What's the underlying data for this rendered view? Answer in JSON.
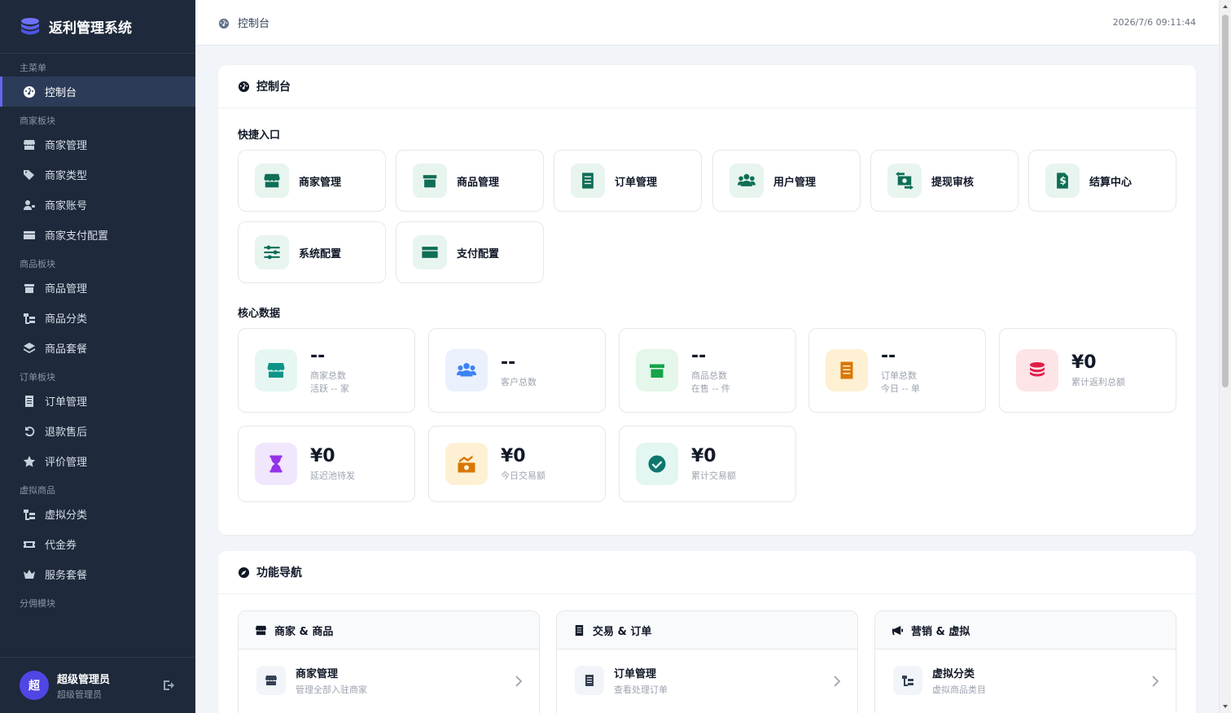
{
  "sidebar": {
    "brand": "返利管理系统",
    "sections": [
      {
        "title": "主菜单",
        "items": [
          {
            "label": "控制台",
            "icon": "dashboard-icon",
            "active": true
          }
        ]
      },
      {
        "title": "商家板块",
        "items": [
          {
            "label": "商家管理",
            "icon": "store-icon"
          },
          {
            "label": "商家类型",
            "icon": "tags-icon"
          },
          {
            "label": "商家账号",
            "icon": "user-key-icon"
          },
          {
            "label": "商家支付配置",
            "icon": "credit-card-icon"
          }
        ]
      },
      {
        "title": "商品板块",
        "items": [
          {
            "label": "商品管理",
            "icon": "box-icon"
          },
          {
            "label": "商品分类",
            "icon": "sitemap-icon"
          },
          {
            "label": "商品套餐",
            "icon": "layers-icon"
          }
        ]
      },
      {
        "title": "订单板块",
        "items": [
          {
            "label": "订单管理",
            "icon": "receipt-icon"
          },
          {
            "label": "退款售后",
            "icon": "undo-icon"
          },
          {
            "label": "评价管理",
            "icon": "star-icon"
          }
        ]
      },
      {
        "title": "虚拟商品",
        "items": [
          {
            "label": "虚拟分类",
            "icon": "sitemap-icon"
          },
          {
            "label": "代金券",
            "icon": "ticket-icon"
          },
          {
            "label": "服务套餐",
            "icon": "crown-icon"
          }
        ]
      },
      {
        "title": "分佣模块",
        "items": []
      }
    ],
    "user": {
      "avatar": "超",
      "name": "超级管理员",
      "role": "超级管理员"
    }
  },
  "topbar": {
    "title": "控制台",
    "time": "2026/7/6 09:11:44"
  },
  "dashboard": {
    "title": "控制台",
    "quick_title": "快捷入口",
    "quick": [
      {
        "label": "商家管理",
        "icon": "store-icon"
      },
      {
        "label": "商品管理",
        "icon": "box-icon"
      },
      {
        "label": "订单管理",
        "icon": "receipt-icon"
      },
      {
        "label": "用户管理",
        "icon": "users-icon"
      },
      {
        "label": "提现审核",
        "icon": "money-exchange-icon"
      },
      {
        "label": "结算中心",
        "icon": "invoice-dollar-icon"
      },
      {
        "label": "系统配置",
        "icon": "sliders-icon"
      },
      {
        "label": "支付配置",
        "icon": "credit-card-icon"
      }
    ],
    "core_title": "核心数据",
    "stats": [
      {
        "value": "--",
        "label": "商家总数",
        "sub": "活跃 -- 家",
        "icon": "store-icon",
        "bg": "#e6f7f3",
        "color": "#0d9488"
      },
      {
        "value": "--",
        "label": "客户总数",
        "sub": "",
        "icon": "users-icon",
        "bg": "#eaf1fd",
        "color": "#3b82f6"
      },
      {
        "value": "--",
        "label": "商品总数",
        "sub": "在售 -- 件",
        "icon": "box-icon",
        "bg": "#e4f7ea",
        "color": "#16a34a"
      },
      {
        "value": "--",
        "label": "订单总数",
        "sub": "今日 -- 单",
        "icon": "receipt-icon",
        "bg": "#fdf0d3",
        "color": "#d97706"
      },
      {
        "value": "¥0",
        "label": "累计返利总额",
        "sub": "",
        "icon": "coins-icon",
        "bg": "#fde4e6",
        "color": "#e11d48"
      },
      {
        "value": "¥0",
        "label": "延迟池待发",
        "sub": "",
        "icon": "hourglass-icon",
        "bg": "#f1e7fd",
        "color": "#9333ea"
      },
      {
        "value": "¥0",
        "label": "今日交易额",
        "sub": "",
        "icon": "trend-up-icon",
        "bg": "#fdf0d3",
        "color": "#d97706"
      },
      {
        "value": "¥0",
        "label": "累计交易额",
        "sub": "",
        "icon": "check-circle-icon",
        "bg": "#e3f6f1",
        "color": "#0f766e"
      }
    ]
  },
  "nav": {
    "title": "功能导航",
    "groups": [
      {
        "title": "商家 & 商品",
        "icon": "store-icon",
        "item": {
          "title": "商家管理",
          "desc": "管理全部入驻商家",
          "icon": "store-icon"
        }
      },
      {
        "title": "交易 & 订单",
        "icon": "receipt-icon",
        "item": {
          "title": "订单管理",
          "desc": "查看处理订单",
          "icon": "receipt-icon"
        }
      },
      {
        "title": "营销 & 虚拟",
        "icon": "megaphone-icon",
        "item": {
          "title": "虚拟分类",
          "desc": "虚拟商品类目",
          "icon": "sitemap-icon"
        }
      }
    ]
  }
}
